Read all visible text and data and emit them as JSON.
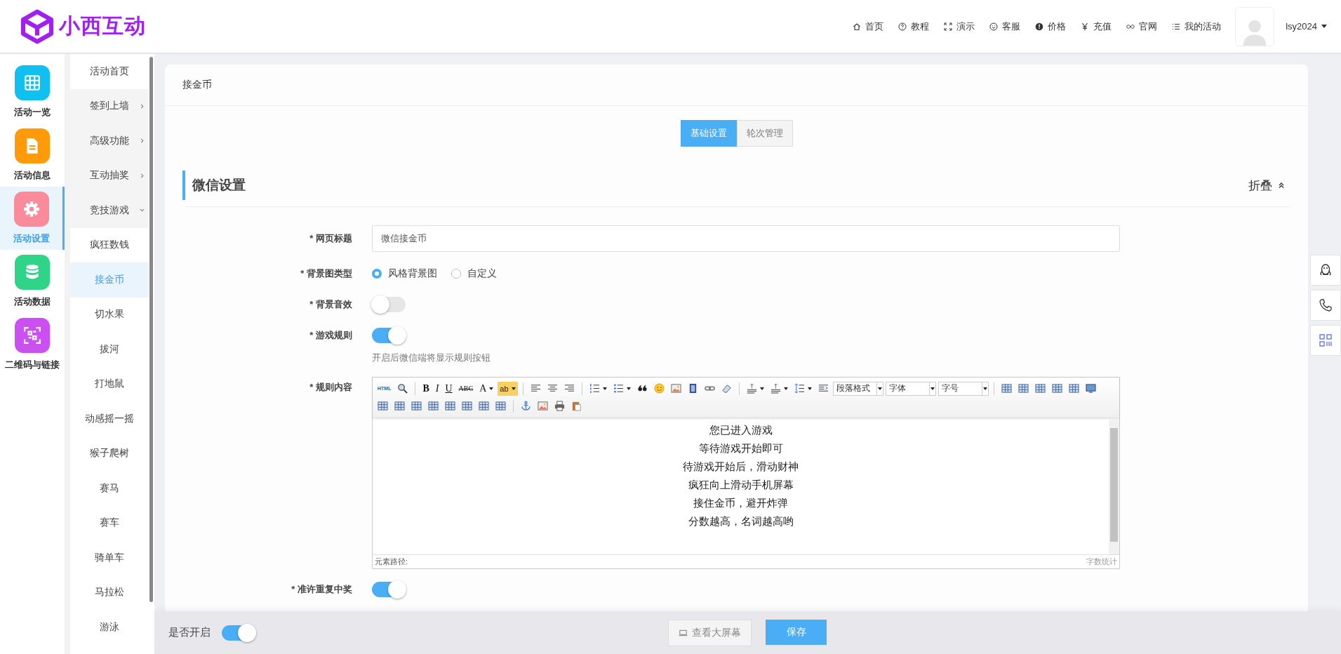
{
  "header": {
    "logo": "小西互动",
    "nav": [
      {
        "kind": "home",
        "label": "首页"
      },
      {
        "kind": "help",
        "label": "教程"
      },
      {
        "kind": "expand",
        "label": "演示"
      },
      {
        "kind": "smile",
        "label": "客服"
      },
      {
        "kind": "badge",
        "label": "价格"
      },
      {
        "kind": "yen",
        "label": "充值"
      },
      {
        "kind": "infinity",
        "label": "官网"
      },
      {
        "kind": "list",
        "label": "我的活动"
      }
    ],
    "user": "lsy2024"
  },
  "sidebar": {
    "items": [
      {
        "kind": "grid",
        "label": "活动一览",
        "color": "#11bff0",
        "selected": false
      },
      {
        "kind": "doc",
        "label": "活动信息",
        "color": "#ff9a0a",
        "selected": false
      },
      {
        "kind": "gear",
        "label": "活动设置",
        "color": "#f98b9b",
        "selected": true
      },
      {
        "kind": "database",
        "label": "活动数据",
        "color": "#2fd488",
        "selected": false
      },
      {
        "kind": "qr",
        "label": "二维码与链接",
        "color": "#cc4ff2",
        "selected": false
      }
    ]
  },
  "submenu": {
    "items": [
      {
        "label": "活动首页",
        "selected": false
      },
      {
        "label": "签到上墙",
        "expanded": false,
        "selected": false
      },
      {
        "label": "高级功能",
        "expanded": false,
        "selected": false
      },
      {
        "label": "互动抽奖",
        "expanded": false,
        "selected": false
      },
      {
        "label": "竞技游戏",
        "expanded": true,
        "selected": false,
        "children": [
          {
            "label": "疯狂数钱",
            "selected": false
          },
          {
            "label": "接金币",
            "selected": true
          },
          {
            "label": "切水果",
            "selected": false
          },
          {
            "label": "拔河",
            "selected": false
          },
          {
            "label": "打地鼠",
            "selected": false
          },
          {
            "label": "动感摇一摇",
            "selected": false
          },
          {
            "label": "猴子爬树",
            "selected": false
          },
          {
            "label": "赛马",
            "selected": false
          },
          {
            "label": "赛车",
            "selected": false
          },
          {
            "label": "骑单车",
            "selected": false
          },
          {
            "label": "马拉松",
            "selected": false
          },
          {
            "label": "游泳",
            "selected": false
          }
        ]
      }
    ]
  },
  "page": {
    "title": "接金币",
    "tabs": [
      {
        "label": "基础设置",
        "selected": true
      },
      {
        "label": "轮次管理",
        "selected": false
      }
    ],
    "section": {
      "title": "微信设置",
      "collapse": "折叠"
    },
    "fields": [
      {
        "kind": "text",
        "label": "* 网页标题",
        "value": "微信接金币"
      },
      {
        "kind": "radio",
        "label": "* 背景图类型",
        "options": [
          {
            "label": "风格背景图",
            "selected": true
          },
          {
            "label": "自定义",
            "selected": false
          }
        ]
      },
      {
        "kind": "toggle",
        "label": "* 背景音效",
        "on": false
      },
      {
        "kind": "toggle",
        "label": "* 游戏规则",
        "on": true,
        "hint": "开启后微信端将显示规则按钮"
      },
      {
        "kind": "editor",
        "label": "* 规则内容",
        "toolbar_rows": [
          [
            {
              "kind": "html",
              "label": "HTML"
            },
            {
              "kind": "search"
            },
            {
              "kind": "separator"
            },
            {
              "kind": "bold",
              "label": "B"
            },
            {
              "kind": "italic",
              "label": "I"
            },
            {
              "kind": "underline",
              "label": "U"
            },
            {
              "kind": "strike",
              "label": "ABC"
            },
            {
              "kind": "color",
              "label": "A",
              "dropdown": true
            },
            {
              "kind": "highlight",
              "label": "ab",
              "dropdown": true
            },
            {
              "kind": "separator"
            },
            {
              "kind": "align-left"
            },
            {
              "kind": "align-center"
            },
            {
              "kind": "align-right"
            },
            {
              "kind": "separator"
            },
            {
              "kind": "ordered-list",
              "dropdown": true
            },
            {
              "kind": "bullet-list",
              "dropdown": true
            },
            {
              "kind": "quote"
            },
            {
              "kind": "emoji"
            },
            {
              "kind": "image"
            },
            {
              "kind": "film"
            },
            {
              "kind": "link"
            },
            {
              "kind": "eraser"
            },
            {
              "kind": "separator"
            },
            {
              "kind": "spacing",
              "dropdown": true
            },
            {
              "kind": "spacing",
              "dropdown": true
            },
            {
              "kind": "line-height",
              "dropdown": true
            },
            {
              "kind": "indent"
            },
            {
              "kind": "select",
              "label": "段落格式"
            },
            {
              "kind": "select",
              "label": "字体"
            },
            {
              "kind": "select",
              "label": "字号"
            },
            {
              "kind": "separator"
            },
            {
              "kind": "table"
            },
            {
              "kind": "table"
            },
            {
              "kind": "table"
            },
            {
              "kind": "table"
            },
            {
              "kind": "table"
            },
            {
              "kind": "monitor"
            }
          ],
          [
            {
              "kind": "table"
            },
            {
              "kind": "table"
            },
            {
              "kind": "table"
            },
            {
              "kind": "table"
            },
            {
              "kind": "table"
            },
            {
              "kind": "table"
            },
            {
              "kind": "table"
            },
            {
              "kind": "table"
            },
            {
              "kind": "separator"
            },
            {
              "kind": "anchor"
            },
            {
              "kind": "image"
            },
            {
              "kind": "printer"
            },
            {
              "kind": "clipboard"
            }
          ]
        ],
        "lines": [
          "您已进入游戏",
          "等待游戏开始即可",
          "待游戏开始后，滑动财神",
          "疯狂向上滑动手机屏幕",
          "接住金币，避开炸弹",
          "分数越高，名词越高哟"
        ],
        "path_label": "元素路径:",
        "count_label": "字数统计"
      },
      {
        "kind": "toggle",
        "label": "* 准许重复中奖",
        "on": true
      }
    ]
  },
  "bottom_bar": {
    "enable_label": "是否开启",
    "enabled": true,
    "preview_button": "查看大屏幕",
    "save_button": "保存"
  }
}
